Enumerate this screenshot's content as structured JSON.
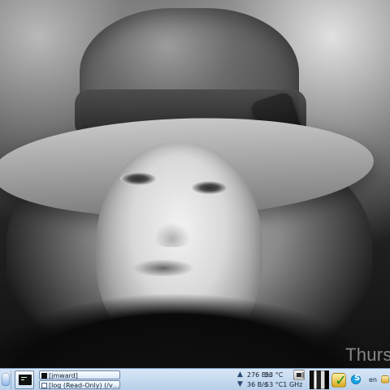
{
  "desktop": {
    "watermark_text": "Thursd"
  },
  "taskbar": {
    "start_icon_name": "start-menu-icon",
    "terminal_icon_name": "terminal-icon",
    "windows": [
      {
        "title": "[jmward]"
      },
      {
        "title": "[log (Read-Only) (/var/l..."
      }
    ],
    "net": {
      "up": "276 B/s",
      "down": "36 B/s"
    },
    "sensors": {
      "temp1": "53 °C",
      "temp2_freq": "53 °C1 GHz"
    },
    "tray": {
      "language": "en"
    },
    "colors": {
      "taskbar_top": "#d7e6f6",
      "taskbar_bottom": "#b8d0ea",
      "border": "#7e9fc5"
    }
  }
}
